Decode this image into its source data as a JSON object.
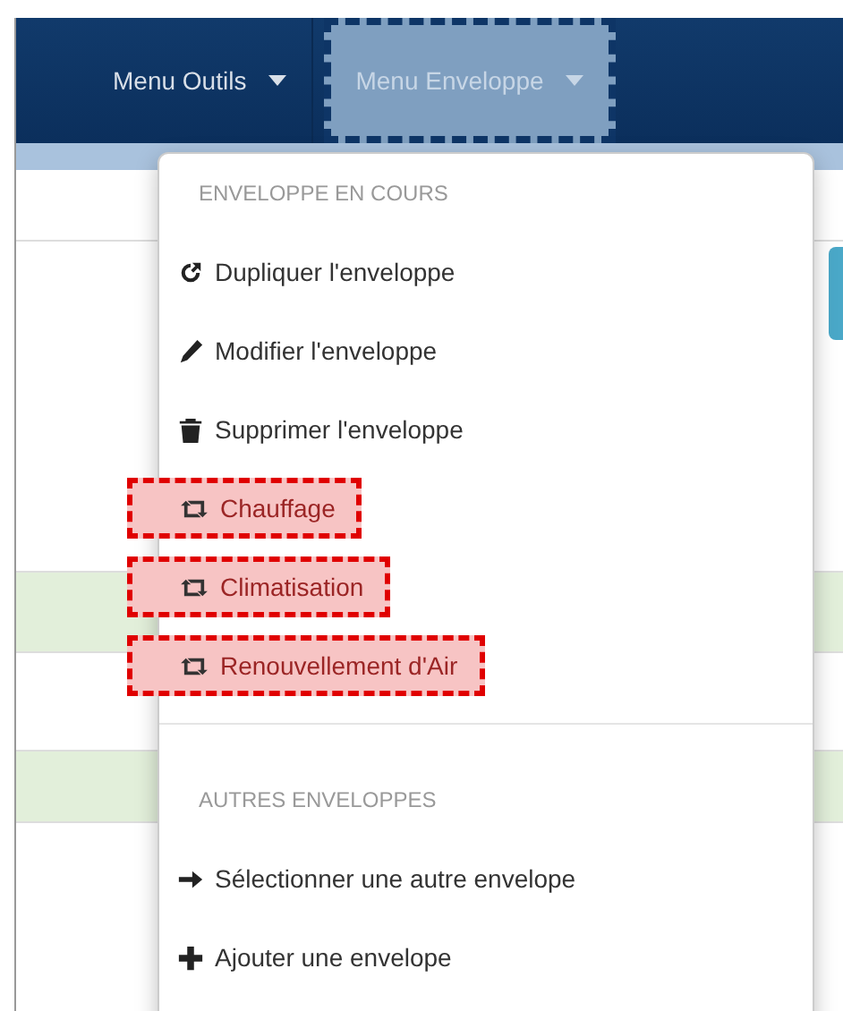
{
  "navbar": {
    "menus": [
      {
        "label": "Menu Outils",
        "selected": false,
        "highlighted": false
      },
      {
        "label": "Menu Enveloppe",
        "selected": true,
        "highlighted": true
      }
    ]
  },
  "dropdown": {
    "sections": [
      {
        "header": "ENVELOPPE EN COURS",
        "items": [
          {
            "kind": "duplicate",
            "label": "Dupliquer l'enveloppe",
            "highlighted": false
          },
          {
            "kind": "edit",
            "label": "Modifier l'enveloppe",
            "highlighted": false
          },
          {
            "kind": "delete",
            "label": "Supprimer l'enveloppe",
            "highlighted": false
          },
          {
            "kind": "link",
            "label": "Chauffage",
            "highlighted": true
          },
          {
            "kind": "link",
            "label": "Climatisation",
            "highlighted": true
          },
          {
            "kind": "link",
            "label": "Renouvellement d'Air",
            "highlighted": true
          }
        ]
      },
      {
        "header": "AUTRES ENVELOPPES",
        "items": [
          {
            "kind": "select",
            "label": "Sélectionner une autre envelope",
            "highlighted": false
          },
          {
            "kind": "add",
            "label": "Ajouter une envelope",
            "highlighted": false
          }
        ]
      }
    ]
  }
}
